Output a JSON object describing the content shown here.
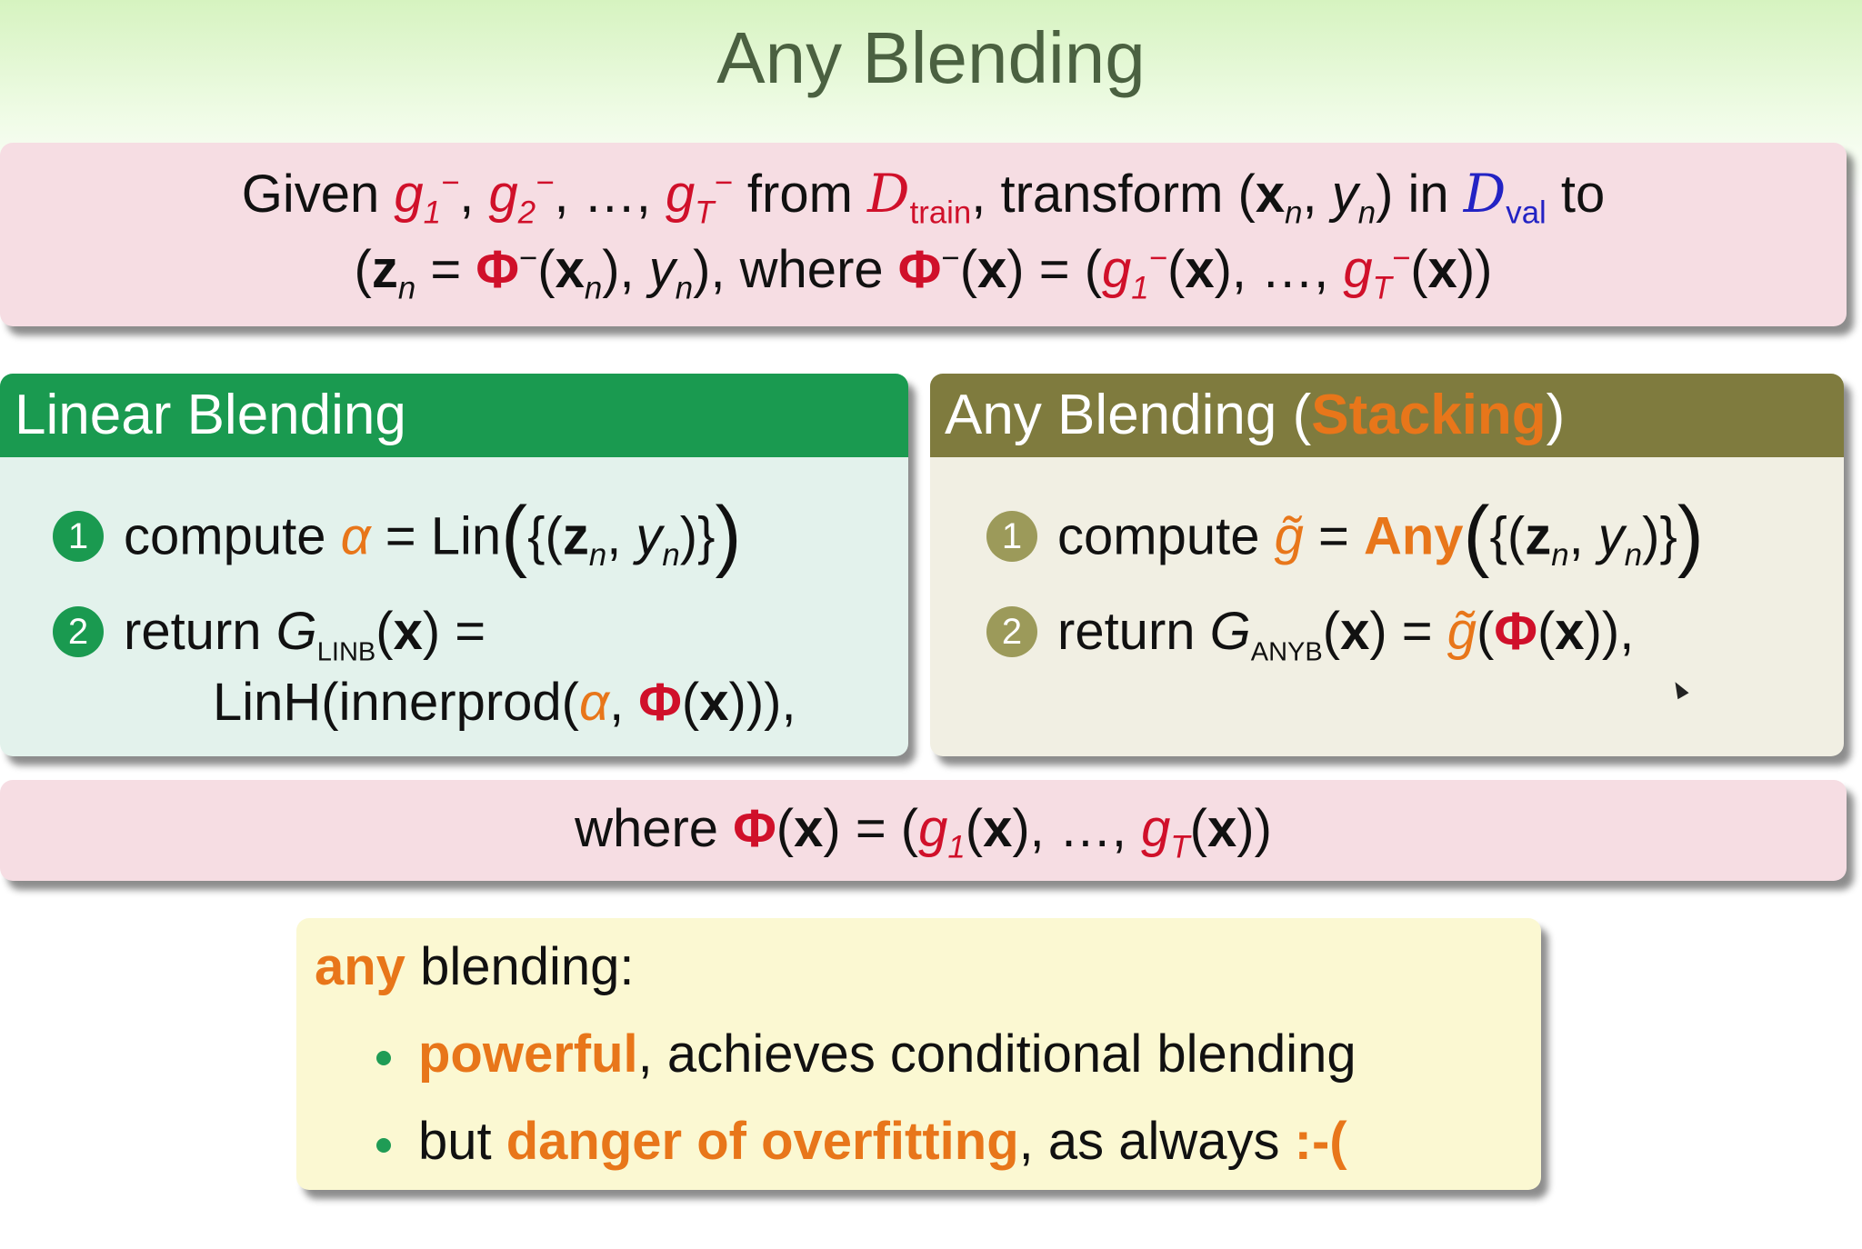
{
  "title": "Any Blending",
  "top_box": {
    "l1": [
      "Given ",
      "g",
      "1",
      "−",
      ", ",
      "g",
      "2",
      "−",
      ", …, ",
      "g",
      "T",
      "−",
      " from ",
      "D",
      "train",
      ", transform (",
      "x",
      "n",
      ", ",
      "y",
      "n",
      ") in ",
      "D",
      "val",
      " to"
    ],
    "l2": [
      "(",
      "z",
      "n",
      " = ",
      "Φ",
      "−",
      "(",
      "x",
      "n",
      "), ",
      "y",
      "n",
      "), where ",
      "Φ",
      "−",
      "(",
      "x",
      ") = (",
      "g",
      "1",
      "−",
      "(",
      "x",
      "), …, ",
      "g",
      "T",
      "−",
      "(",
      "x",
      "))"
    ]
  },
  "linear": {
    "header": "Linear Blending",
    "step1": {
      "num": "1",
      "text": "compute ",
      "alpha": "α",
      "eq": " = Lin",
      "open": "(",
      "set": "{(",
      "z": "z",
      "n": "n",
      ", ": ", ",
      "y": "y",
      "n2": "n",
      "close_set": ")}",
      "close": ")"
    },
    "step2": {
      "num": "2",
      "text": "return ",
      "G": "G",
      "sub": "LINB",
      "arg": "(",
      "x": "x",
      "rest": ") =",
      "l2a": "LinH(innerprod(",
      "alpha": "α",
      ", ": ", ",
      "phi": "Φ",
      "l2b": "(",
      "x2": "x",
      "l2c": "))),"
    }
  },
  "any": {
    "header": "Any Blending (",
    "header_hl": "Stacking",
    "header_end": ")",
    "step1": {
      "num": "1",
      "text": "compute ",
      "g": "g̃",
      "eq": " = ",
      "any": "Any",
      "open": "(",
      "set": "{(",
      "z": "z",
      "n": "n",
      ", ": ", ",
      "y": "y",
      "n2": "n",
      "close_set": ")}",
      "close": ")"
    },
    "step2": {
      "num": "2",
      "text": "return ",
      "G": "G",
      "sub": "ANYB",
      "a": "(",
      "x": "x",
      "b": ") = ",
      "g": "g̃",
      "c": "(",
      "phi": "Φ",
      "d": "(",
      "x2": "x",
      "e": ")),"
    }
  },
  "where_box": [
    "where ",
    "Φ",
    "(",
    "x",
    ") = (",
    "g",
    "1",
    "(",
    "x",
    "), …, ",
    "g",
    "T",
    "(",
    "x",
    "))"
  ],
  "summary": {
    "head_hl": "any",
    "head": " blending:",
    "b1_hl": "powerful",
    "b1": ", achieves conditional blending",
    "b2a": "but ",
    "b2_hl": "danger of overfitting",
    "b2b": ", as always ",
    "b2_face": ":-("
  },
  "colors": {
    "green": "#1a9a50",
    "olive": "#7f7b3e",
    "orange": "#e8761a",
    "red": "#d0102a",
    "blue": "#2323c4"
  }
}
